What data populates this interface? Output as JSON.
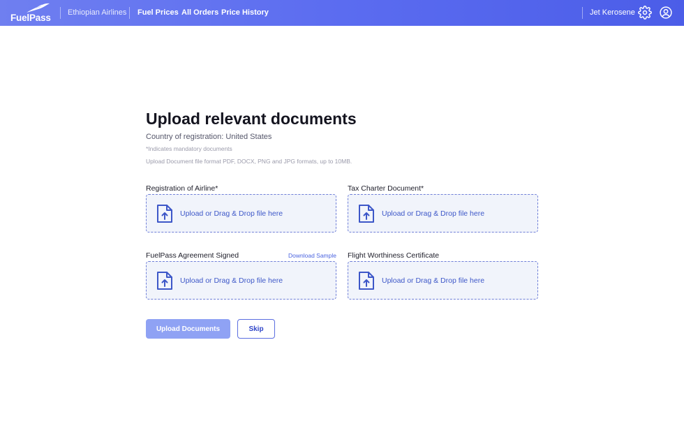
{
  "header": {
    "logo_text": "FuelPass",
    "airline": "Ethiopian Airlines",
    "nav": [
      {
        "label": "Fuel Prices"
      },
      {
        "label": "All Orders"
      },
      {
        "label": "Price History"
      }
    ],
    "username": "Jet Kerosene",
    "icons": [
      "settings-gear-icon",
      "user-account-icon"
    ],
    "gradient_colors": [
      "#6f7ff0",
      "#4b5de8"
    ]
  },
  "main": {
    "title": "Upload relevant documents",
    "country": "Country of registration: United States",
    "mandatory_note": "*Indicates mandatory documents",
    "format_note": "Upload Document file format PDF, DOCX, PNG and JPG formats, up to 10MB."
  },
  "documents": [
    {
      "label": "Registration of Airline*",
      "dropzone_text": "Upload or Drag & Drop file here",
      "icon": "file-upload-icon"
    },
    {
      "label": "Tax Charter Document*",
      "dropzone_text": "Upload or Drag & Drop file here",
      "icon": "file-upload-icon"
    },
    {
      "label": "FuelPass Agreement Signed",
      "link": "Download Sample",
      "dropzone_text": "Upload or Drag & Drop file here",
      "icon": "file-upload-icon"
    },
    {
      "label": "Flight Worthiness Certificate",
      "dropzone_text": "Upload or Drag & Drop file here",
      "icon": "file-upload-icon"
    }
  ],
  "actions": {
    "upload_label": "Upload Documents",
    "skip_label": "Skip"
  },
  "colors": {
    "accent": "#4a63e0",
    "dropzone_bg": "#f1f4fb",
    "primary_button": "#8fa2f4"
  }
}
